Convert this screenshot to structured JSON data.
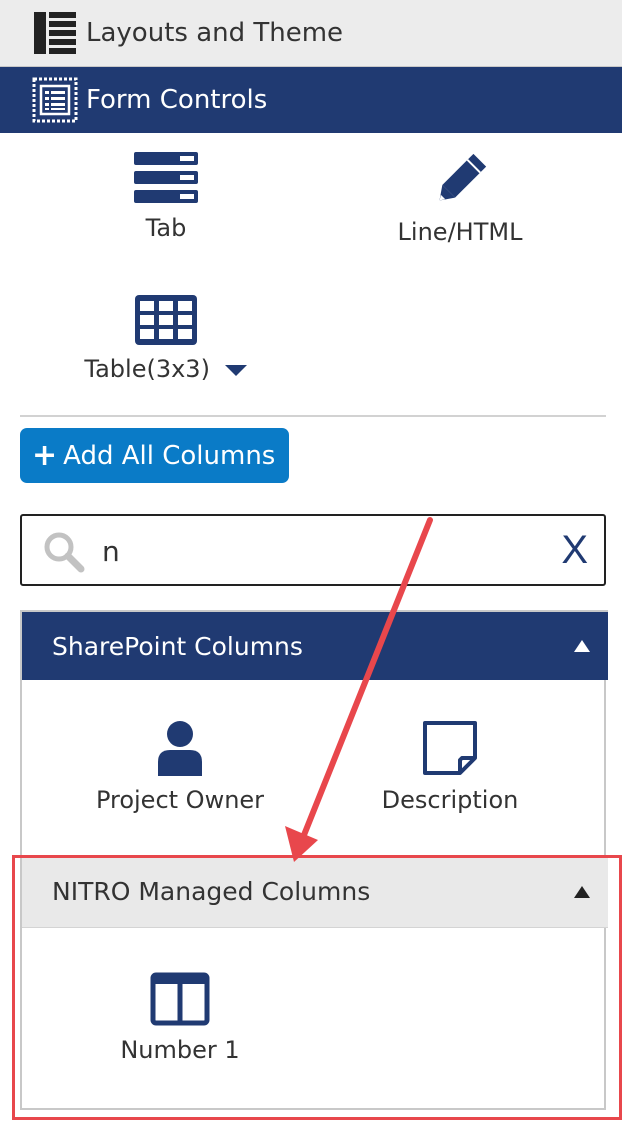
{
  "sidebar": {
    "layouts_label": "Layouts and Theme",
    "form_controls_label": "Form Controls"
  },
  "controls": {
    "tab_label": "Tab",
    "line_html_label": "Line/HTML",
    "table_label": "Table(3x3)"
  },
  "add_button": {
    "label": "Add All Columns"
  },
  "search": {
    "value": "n",
    "clear_label": "X"
  },
  "groups": {
    "sharepoint": {
      "title": "SharePoint Columns",
      "items": [
        {
          "label": "Project Owner",
          "icon": "person-icon"
        },
        {
          "label": "Description",
          "icon": "note-icon"
        }
      ]
    },
    "nitro": {
      "title": "NITRO Managed Columns",
      "items": [
        {
          "label": "Number 1",
          "icon": "two-column-icon"
        }
      ]
    }
  },
  "colors": {
    "navy": "#203a72",
    "button_blue": "#0a7bc7",
    "annotation_red": "#e8474c",
    "header_gray": "#ececec"
  }
}
